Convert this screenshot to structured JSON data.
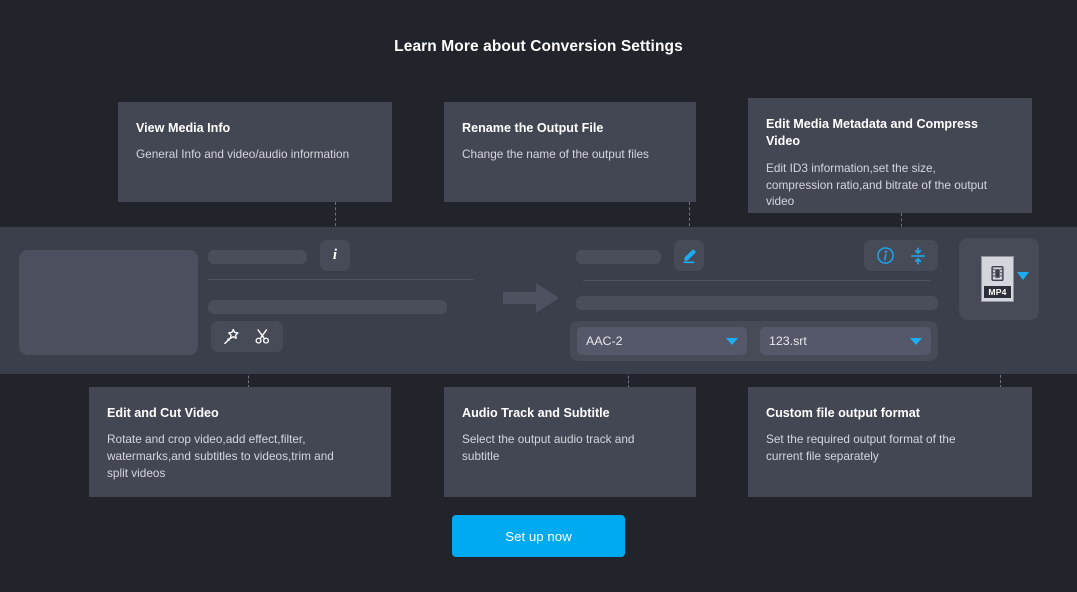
{
  "page": {
    "title": "Learn More about Conversion Settings",
    "background_color": "#22242c",
    "band_color": "#3b3e4b",
    "card_color": "#434754",
    "accent_color": "#00aaf0",
    "accent_icon_color": "#1cacf4"
  },
  "top_cards": [
    {
      "title": "View Media Info",
      "desc": "General Info and video/audio information",
      "icon": "info-icon"
    },
    {
      "title": "Rename the Output File",
      "desc": "Change the name of the output files",
      "icon": "pencil-icon"
    },
    {
      "title": "Edit Media Metadata and Compress Video",
      "desc": "Edit ID3 information,set the size,\ncompression ratio,and bitrate of the output video",
      "icon": "info-circle-icon"
    }
  ],
  "bottom_cards": [
    {
      "title": "Edit and Cut Video",
      "desc": "Rotate and crop video,add effect,filter,\nwatermarks,and subtitles to videos,trim and\nsplit videos",
      "icon": "magic-wand-icon"
    },
    {
      "title": "Audio Track and Subtitle",
      "desc": "Select the output audio track and\nsubtitle",
      "icon": "dropdown-icon"
    },
    {
      "title": "Custom file output format",
      "desc": "Set the required output format of the\ncurrent file separately",
      "icon": "mp4-badge-icon"
    }
  ],
  "mock_ui": {
    "info_chip_glyph": "i",
    "edit_tools": [
      "magic-wand-icon",
      "scissors-icon"
    ],
    "pencil_icon": "pencil-icon",
    "metadata_tools": [
      "info-circle-icon",
      "compress-icon"
    ],
    "audio_dropdown": {
      "value": "AAC-2",
      "caret": "caret-down-icon"
    },
    "subtitle_dropdown": {
      "value": "123.srt",
      "caret": "caret-down-icon"
    },
    "format_badge": {
      "label": "MP4",
      "icon": "film-strip-icon",
      "caret": "caret-down-icon"
    },
    "flow_arrow": "arrow-right-icon"
  },
  "cta": {
    "label": "Set up now"
  }
}
